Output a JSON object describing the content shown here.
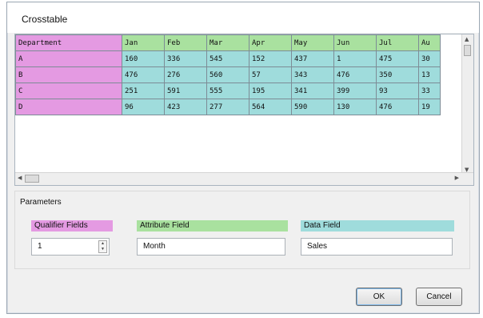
{
  "dialog": {
    "title": "Crosstable"
  },
  "grid": {
    "columns": [
      "Department",
      "Jan",
      "Feb",
      "Mar",
      "Apr",
      "May",
      "Jun",
      "Jul",
      "Au"
    ],
    "rows": [
      [
        "A",
        "160",
        "336",
        "545",
        "152",
        "437",
        "1",
        "475",
        "30"
      ],
      [
        "B",
        "476",
        "276",
        "560",
        "57",
        "343",
        "476",
        "350",
        "13"
      ],
      [
        "C",
        "251",
        "591",
        "555",
        "195",
        "341",
        "399",
        "93",
        "33"
      ],
      [
        "D",
        "96",
        "423",
        "277",
        "564",
        "590",
        "130",
        "476",
        "19"
      ]
    ]
  },
  "parameters": {
    "title": "Parameters",
    "qualifier_label": "Qualifier Fields",
    "qualifier_value": "1",
    "attribute_label": "Attribute Field",
    "attribute_value": "Month",
    "data_label": "Data Field",
    "data_value": "Sales"
  },
  "buttons": {
    "ok": "OK",
    "cancel": "Cancel"
  },
  "colors": {
    "qualifier": "#e49ae2",
    "attribute": "#a9e19f",
    "data": "#9fdcdc"
  }
}
